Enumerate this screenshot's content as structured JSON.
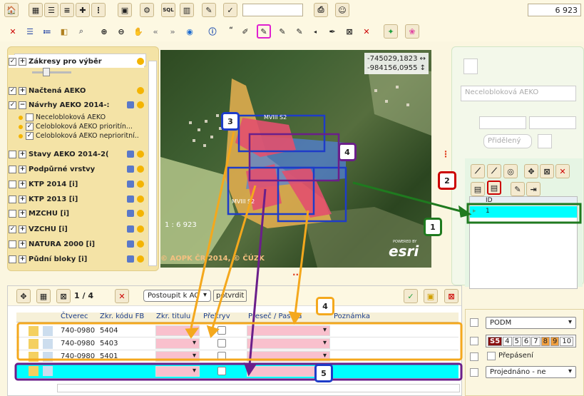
{
  "toolbar": {
    "scale_value": "6 923"
  },
  "layers": {
    "items": [
      {
        "label": "Zákresy pro výběr",
        "checked": "✓"
      },
      {
        "label": "Načtená AEKO",
        "checked": "✓"
      },
      {
        "label": "Návrhy AEKO 2014-:",
        "checked": "✓",
        "expand": "−"
      },
      {
        "label": "Stavy AEKO 2014-2(",
        "checked": ""
      },
      {
        "label": "Podpůrné vrstvy",
        "checked": ""
      },
      {
        "label": "KTP 2014 [i]",
        "checked": ""
      },
      {
        "label": "KTP 2013 [i]",
        "checked": ""
      },
      {
        "label": "MZCHÚ [i]",
        "checked": ""
      },
      {
        "label": "VZCHÚ [i]",
        "checked": "✓"
      },
      {
        "label": "NATURA 2000 [i]",
        "checked": ""
      },
      {
        "label": "Půdní bloky [i]",
        "checked": ""
      }
    ],
    "subitems": [
      {
        "label": "Necelobloková AEKO",
        "checked": ""
      },
      {
        "label": "Celobloková AEKO prioritín...",
        "checked": "✓"
      },
      {
        "label": "Celobloková AEKO neprioritní..",
        "checked": "✓"
      }
    ]
  },
  "map": {
    "coord_x": "-745029,1823 ↔",
    "coord_y": "-984156,0955 ↕",
    "scale_text": "1 : 6 923",
    "copyright": "© AOPK ČR 2014, © ČÚZK",
    "esri": "esri",
    "powered": "POWERED BY",
    "labels": [
      "MVIII S2",
      "MVIII S2",
      "MVIII S2"
    ]
  },
  "right_panel": {
    "select1": "Necelobloková AEKO",
    "select2": "Přidělený",
    "grid_header": "ID",
    "grid_value": "1"
  },
  "bottom": {
    "pager": "1 / 4",
    "step_select": "Postoupit k AO",
    "confirm": "potvrdit",
    "columns": [
      "Čtverec",
      "Zkr. kódu FB",
      "Zkr. titulu",
      "Překryv",
      "Přeseč / Pastva",
      "Poznámka"
    ],
    "rows": [
      {
        "ctverec": "740-0980",
        "kod": "5404"
      },
      {
        "ctverec": "740-0980",
        "kod": "5403"
      },
      {
        "ctverec": "740-0980",
        "kod": "5401"
      }
    ],
    "right": {
      "podm": "PODM",
      "numbers": [
        "S5",
        "4",
        "5",
        "6",
        "7",
        "8",
        "9",
        "10"
      ],
      "prepaseni": "Přepásení",
      "projednano": "Projednáno - ne"
    }
  },
  "callouts": [
    "1",
    "2",
    "3",
    "4",
    "4",
    "5"
  ],
  "colors": {
    "orange": "#f4a81d",
    "purple": "#6b1f8a",
    "green": "#1f7a1f",
    "red": "#cc0000",
    "blue": "#1e3cc8",
    "cyan": "#00ffff",
    "pink": "#f9c0cd"
  }
}
